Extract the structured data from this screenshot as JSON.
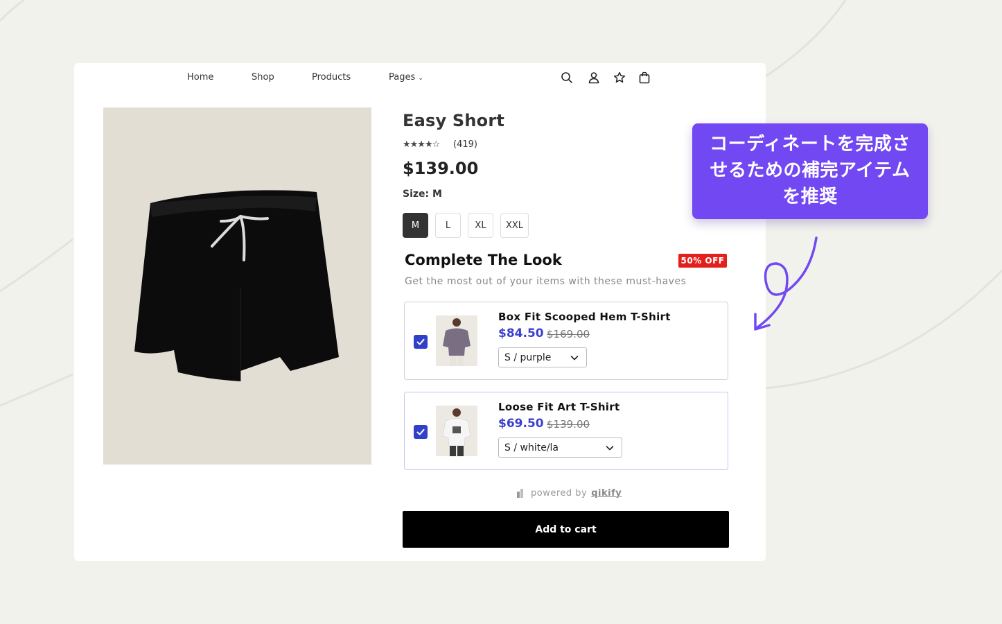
{
  "nav": {
    "links": [
      "Home",
      "Shop",
      "Products",
      "Pages"
    ],
    "icons": [
      "search-icon",
      "user-icon",
      "wishlist-star-icon",
      "shopping-bag-icon"
    ]
  },
  "product": {
    "title": "Easy Short",
    "rating_stars": "★★★★☆",
    "rating": 4,
    "reviews": "(419)",
    "price": "$139.00",
    "size_label": "Size: M",
    "sizes": [
      "M",
      "L",
      "XL",
      "XXL"
    ],
    "selected_size": "M"
  },
  "complete_look": {
    "title": "Complete The Look",
    "badge": "50% OFF",
    "subtitle": "Get the most out of your items with these must-haves",
    "items": [
      {
        "name": "Box Fit Scooped Hem T-Shirt",
        "price": "$84.50",
        "old_price": "$169.00",
        "variant": "S / purple",
        "checked": true
      },
      {
        "name": "Loose Fit Art T-Shirt",
        "price": "$69.50",
        "old_price": "$139.00",
        "variant": "S / white/la",
        "checked": true
      }
    ]
  },
  "powered": {
    "prefix": "powered by",
    "brand": "qikify"
  },
  "cart": {
    "button_label": "Add to cart"
  },
  "callout": {
    "text": "コーディネートを完成させるための補完アイテムを推奨"
  },
  "colors": {
    "accent": "#7248f3",
    "price_blue": "#3b3fcc",
    "badge_red": "#e3201c",
    "checkbox": "#3040c9"
  }
}
